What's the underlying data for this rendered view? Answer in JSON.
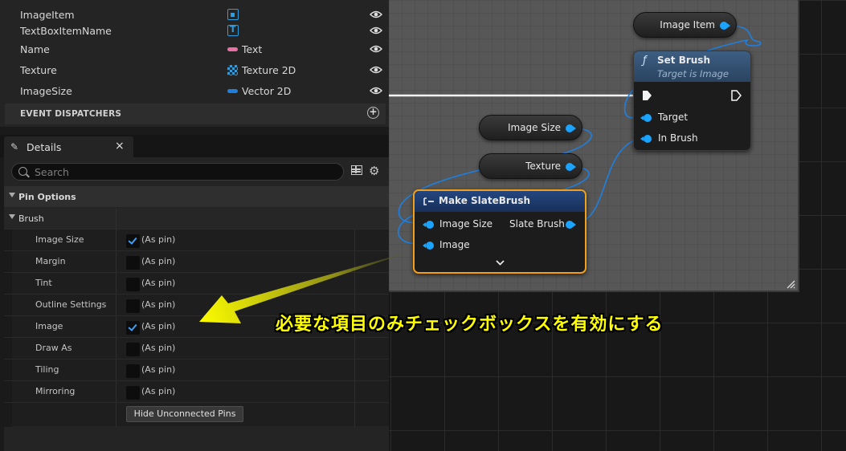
{
  "variables": [
    {
      "name": "ImageItem",
      "type_label": "",
      "icon": "image-widget-icon"
    },
    {
      "name": "TextBoxItemName",
      "type_label": "",
      "icon": "text-widget-icon"
    },
    {
      "name": "Name",
      "type_label": "Text",
      "icon": "pink-pill-icon",
      "color": "#e96fa5"
    },
    {
      "name": "Texture",
      "type_label": "Texture 2D",
      "icon": "texture-checker-icon"
    },
    {
      "name": "ImageSize",
      "type_label": "Vector 2D",
      "icon": "blue-pill-icon",
      "color": "#1f7fe0"
    }
  ],
  "event_dispatchers": {
    "label": "EVENT DISPATCHERS"
  },
  "details_tab": {
    "label": "Details",
    "close": "×"
  },
  "search": {
    "placeholder": "Search"
  },
  "categories": {
    "pin_options": "Pin Options",
    "brush": "Brush"
  },
  "pin_rows": [
    {
      "label": "Image Size",
      "checked": true,
      "value": "(As pin)"
    },
    {
      "label": "Margin",
      "checked": false,
      "value": "(As pin)"
    },
    {
      "label": "Tint",
      "checked": false,
      "value": "(As pin)"
    },
    {
      "label": "Outline Settings",
      "checked": false,
      "value": "(As pin)"
    },
    {
      "label": "Image",
      "checked": true,
      "value": "(As pin)"
    },
    {
      "label": "Draw As",
      "checked": false,
      "value": "(As pin)"
    },
    {
      "label": "Tiling",
      "checked": false,
      "value": "(As pin)"
    },
    {
      "label": "Mirroring",
      "checked": false,
      "value": "(As pin)"
    }
  ],
  "hide_button": "Hide Unconnected Pins",
  "graph": {
    "getters": {
      "image_item": "Image Item",
      "image_size": "Image Size",
      "texture": "Texture"
    },
    "set_brush": {
      "title": "Set Brush",
      "subtitle": "Target is Image",
      "func_icon": "ƒ",
      "target": "Target",
      "in_brush": "In Brush"
    },
    "make_slate": {
      "title": "Make SlateBrush",
      "image_size": "Image Size",
      "image": "Image",
      "slate_brush": "Slate Brush",
      "expand": "⌄"
    }
  },
  "annotation": "必要な項目のみチェックボックスを有効にする",
  "colors": {
    "accent_blue": "#1aa3ff",
    "selection_orange": "#f2a01c",
    "annotation_yellow": "#ffff00",
    "set_brush_header": "#2f4a6a",
    "make_slate_header": "#1d3a72"
  }
}
